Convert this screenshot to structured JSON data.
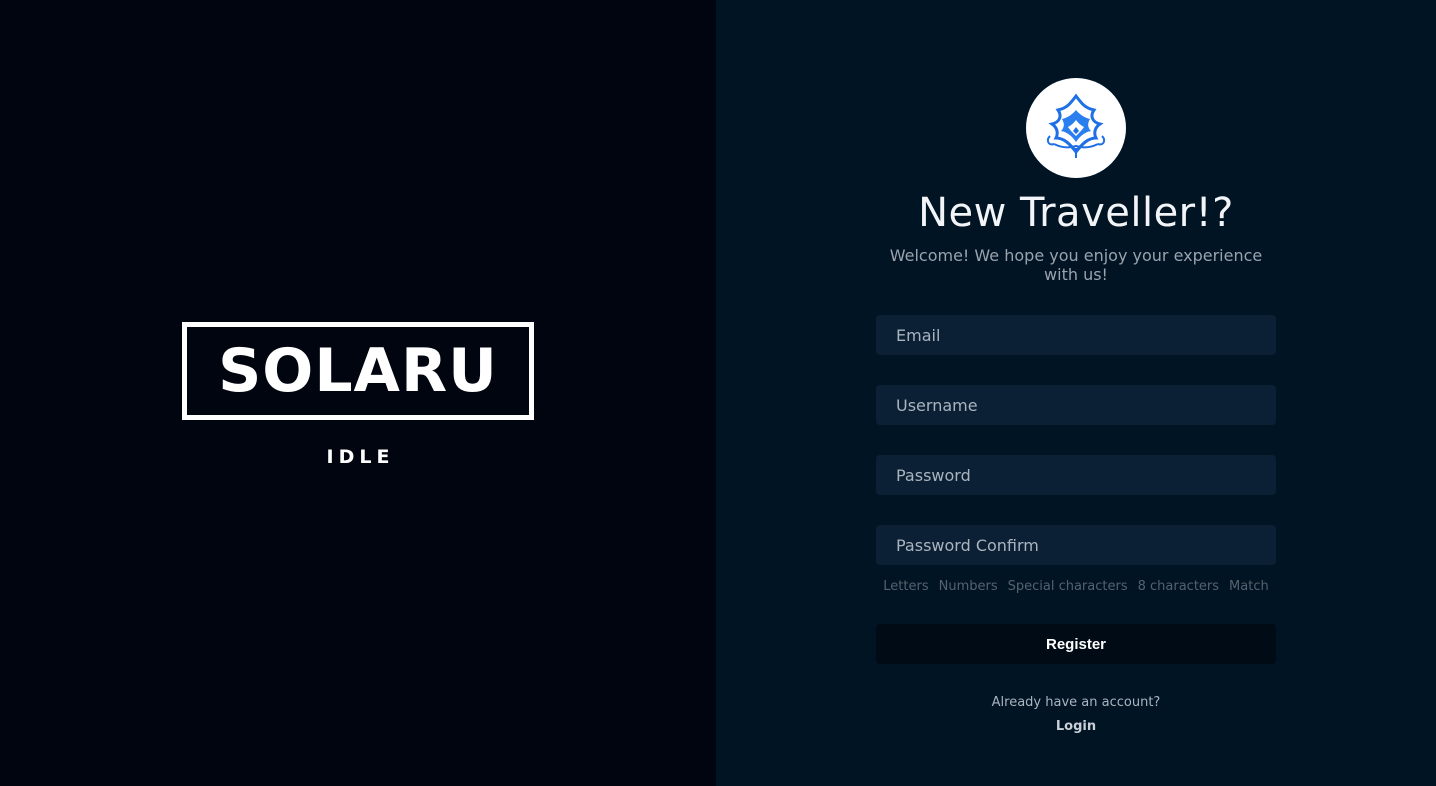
{
  "brand": {
    "logo_text": "SOLARU",
    "logo_subtext": "IDLE"
  },
  "register": {
    "emblem_icon": "lotus-emblem-icon",
    "title": "New Traveller!?",
    "subtitle": "Welcome! We hope you enjoy your experience with us!",
    "fields": {
      "email_placeholder": "Email",
      "username_placeholder": "Username",
      "password_placeholder": "Password",
      "password_confirm_placeholder": "Password Confirm"
    },
    "password_rules": [
      "Letters",
      "Numbers",
      "Special characters",
      "8 characters",
      "Match"
    ],
    "register_label": "Register",
    "already_text": "Already have an account?",
    "login_label": "Login"
  },
  "colors": {
    "left_bg": "#00050f",
    "right_bg": "#011424",
    "field_bg": "#0b2035",
    "button_bg": "#000b16",
    "emblem_blue": "#1f6fe6"
  }
}
